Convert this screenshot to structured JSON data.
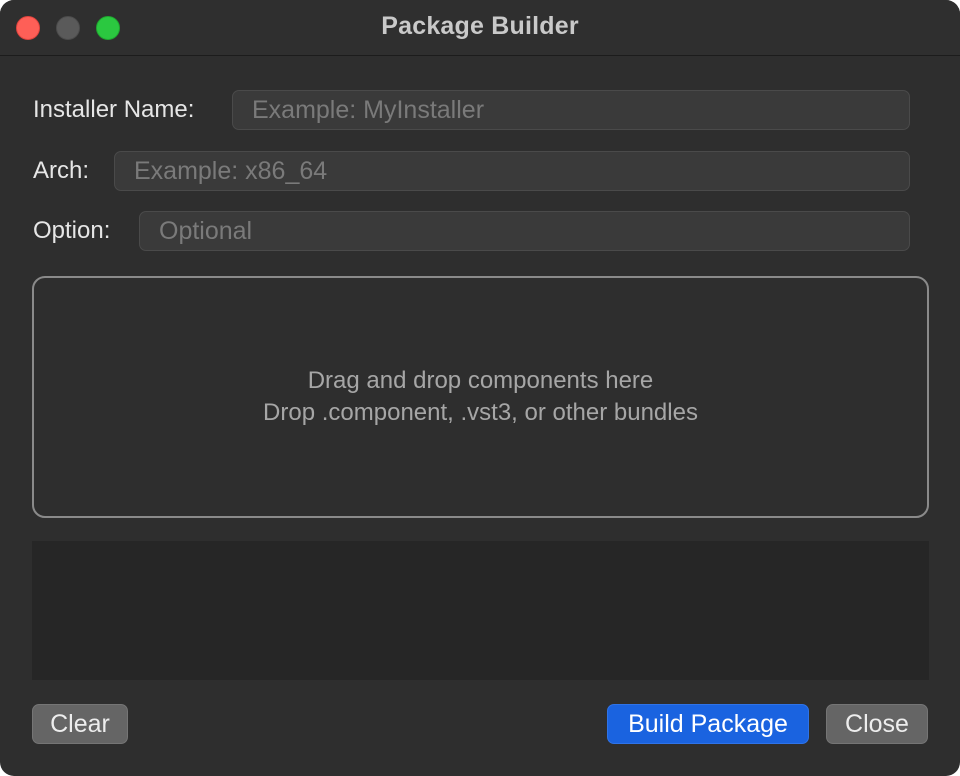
{
  "window": {
    "title": "Package Builder"
  },
  "form": {
    "installer_name": {
      "label": "Installer Name:",
      "value": "",
      "placeholder": "Example: MyInstaller"
    },
    "arch": {
      "label": "Arch:",
      "value": "",
      "placeholder": "Example: x86_64"
    },
    "option": {
      "label": "Option:",
      "value": "",
      "placeholder": "Optional"
    }
  },
  "dropzone": {
    "line1": "Drag and drop components here",
    "line2": "Drop .component, .vst3, or other bundles"
  },
  "buttons": {
    "clear": "Clear",
    "build": "Build Package",
    "close": "Close"
  },
  "colors": {
    "window_bg": "#2e2e2e",
    "accent": "#1a63e0",
    "close_dot": "#fe5f57",
    "zoom_dot": "#2bc840"
  }
}
